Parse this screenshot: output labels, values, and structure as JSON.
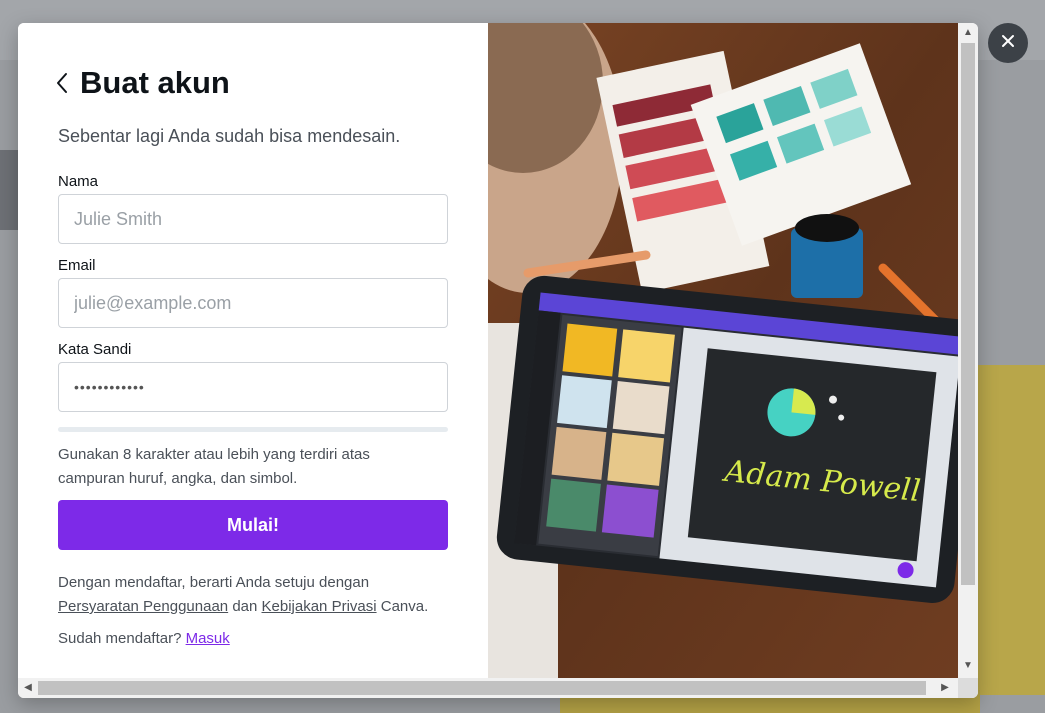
{
  "modal": {
    "title": "Buat akun",
    "subtitle": "Sebentar lagi Anda sudah bisa mendesain."
  },
  "form": {
    "name": {
      "label": "Nama",
      "placeholder": "Julie Smith",
      "value": ""
    },
    "email": {
      "label": "Email",
      "placeholder": "julie@example.com",
      "value": ""
    },
    "password": {
      "label": "Kata Sandi",
      "value": "••••••••••••"
    },
    "password_hint": "Gunakan 8 karakter atau lebih yang terdiri atas campuran huruf, angka, dan simbol.",
    "submit_label": "Mulai!"
  },
  "terms": {
    "prefix": "Dengan mendaftar, berarti Anda setuju dengan",
    "terms_link": "Persyaratan Penggunaan",
    "and": "dan",
    "privacy_link": "Kebijakan Privasi",
    "suffix": "Canva."
  },
  "signin": {
    "prompt": "Sudah mendaftar?",
    "link": "Masuk"
  },
  "illustration": {
    "tablet_signature": "Adam Powell"
  },
  "colors": {
    "accent": "#7d2ae8",
    "title": "#0e1318",
    "body_text": "#4a5058"
  },
  "icons": {
    "back": "chevron-left-icon",
    "close": "close-icon"
  }
}
